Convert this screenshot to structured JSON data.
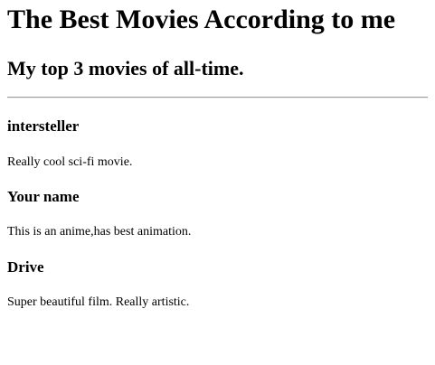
{
  "page": {
    "title": "The Best Movies According to me",
    "subtitle": "My top 3 movies of all-time."
  },
  "movies": [
    {
      "title": "intersteller",
      "description": "Really cool sci-fi movie."
    },
    {
      "title": "Your name",
      "description": "This is an anime,has best animation."
    },
    {
      "title": "Drive",
      "description": "Super beautiful film. Really artistic."
    }
  ]
}
